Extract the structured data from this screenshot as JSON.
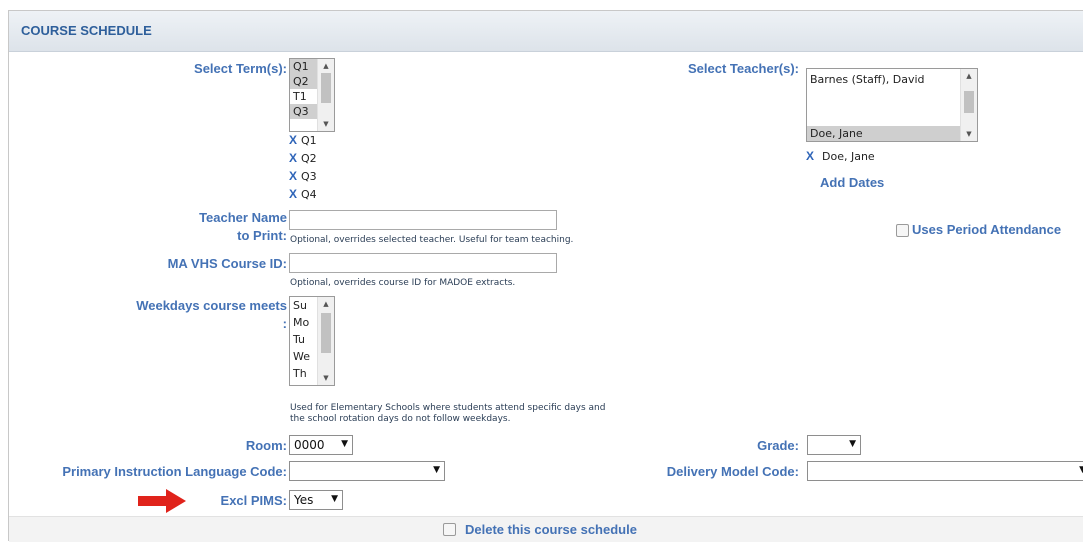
{
  "header": {
    "title": "COURSE SCHEDULE"
  },
  "terms": {
    "label": "Select Term(s):",
    "options": [
      {
        "text": "Q1",
        "selected": true
      },
      {
        "text": "Q2",
        "selected": true
      },
      {
        "text": "T1",
        "selected": false
      },
      {
        "text": "Q3",
        "selected": true
      }
    ],
    "chips": [
      "Q1",
      "Q2",
      "Q3",
      "Q4"
    ],
    "remove_glyph": "X"
  },
  "teachers": {
    "label": "Select Teacher(s):",
    "options": [
      {
        "text": "Barnes (Staff), David",
        "selected": false
      },
      {
        "text": "Doe, Jane",
        "selected": true
      }
    ],
    "chip": "Doe, Jane",
    "remove_glyph": "X",
    "add_dates": "Add Dates"
  },
  "period_attendance": {
    "label": "Uses Period Attendance",
    "checked": false
  },
  "teacher_name": {
    "label_line1": "Teacher Name",
    "label_line2": "to Print:",
    "value": "",
    "hint": "Optional, overrides selected teacher. Useful for team teaching."
  },
  "ma_vhs": {
    "label": "MA VHS Course ID:",
    "value": "",
    "hint": "Optional, overrides course ID for MADOE extracts."
  },
  "weekdays": {
    "label_line1": "Weekdays course meets",
    "label_line2": ":",
    "options": [
      "Su",
      "Mo",
      "Tu",
      "We",
      "Th"
    ],
    "hint_line1": "Used for Elementary Schools where students attend specific days and",
    "hint_line2": "the school rotation days do not follow weekdays."
  },
  "room": {
    "label": "Room:",
    "value": "0000"
  },
  "grade": {
    "label": "Grade:",
    "value": ""
  },
  "primary_language": {
    "label": "Primary Instruction Language Code:",
    "value": ""
  },
  "delivery_model": {
    "label": "Delivery Model Code:",
    "value": ""
  },
  "excl_pims": {
    "label": "Excl PIMS:",
    "value": "Yes"
  },
  "delete": {
    "label": "Delete this course schedule",
    "checked": false
  },
  "colors": {
    "accent": "#4472b5",
    "header_text": "#2e5f9b",
    "arrow": "#e0231b"
  }
}
